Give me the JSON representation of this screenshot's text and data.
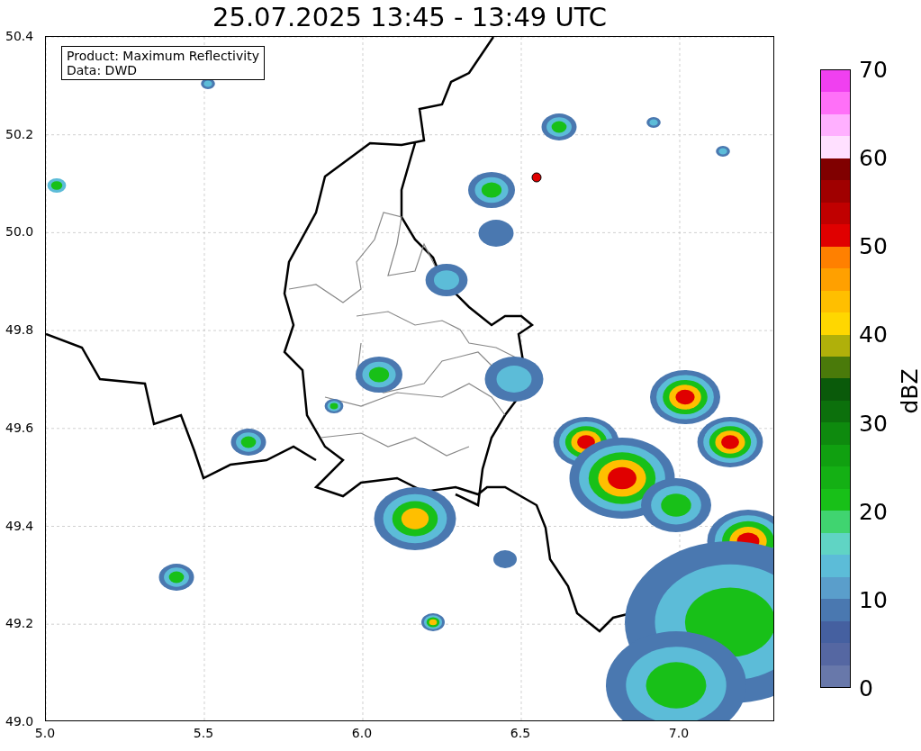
{
  "title": "25.07.2025 13:45 - 13:49 UTC",
  "info_box": {
    "lines": [
      "Product: Maximum Reflectivity",
      "Data: DWD"
    ]
  },
  "x_axis": {
    "ticks": [
      "5.0",
      "5.5",
      "6.0",
      "6.5",
      "7.0"
    ]
  },
  "y_axis": {
    "ticks": [
      "50.4",
      "50.2",
      "50.0",
      "49.8",
      "49.6",
      "49.4",
      "49.2",
      "49.0"
    ]
  },
  "colorbar": {
    "label": "dBZ",
    "ticks": [
      "70",
      "60",
      "50",
      "40",
      "30",
      "20",
      "10",
      "0"
    ],
    "segments": [
      {
        "color": "#6878aa"
      },
      {
        "color": "#5567a2"
      },
      {
        "color": "#4560a0"
      },
      {
        "color": "#4a78b0"
      },
      {
        "color": "#5a9ecb"
      },
      {
        "color": "#5cbcd8"
      },
      {
        "color": "#60d4c4"
      },
      {
        "color": "#40d470"
      },
      {
        "color": "#18c018"
      },
      {
        "color": "#14b014"
      },
      {
        "color": "#10a010"
      },
      {
        "color": "#0e8a0e"
      },
      {
        "color": "#0c700c"
      },
      {
        "color": "#0a5a0a"
      },
      {
        "color": "#4a7a0a"
      },
      {
        "color": "#b0b00a"
      },
      {
        "color": "#ffd700"
      },
      {
        "color": "#ffbf00"
      },
      {
        "color": "#ffa000"
      },
      {
        "color": "#ff8000"
      },
      {
        "color": "#e00000"
      },
      {
        "color": "#c00000"
      },
      {
        "color": "#a00000"
      },
      {
        "color": "#800000"
      },
      {
        "color": "#ffe0ff"
      },
      {
        "color": "#ffb0ff"
      },
      {
        "color": "#ff70f8"
      },
      {
        "color": "#f040f0"
      }
    ]
  }
}
